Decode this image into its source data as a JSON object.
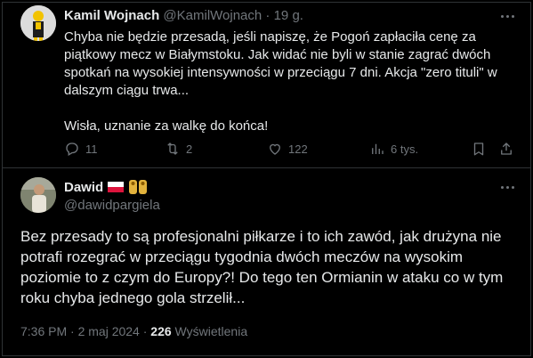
{
  "tweet1": {
    "name": "Kamil Wojnach",
    "handle": "@KamilWojnach",
    "time": "19 g.",
    "text": "Chyba nie będzie przesadą, jeśli napiszę, że Pogoń zapłaciła cenę za piątkowy mecz w Białymstoku. Jak widać nie byli w stanie zagrać dwóch spotkań na wysokiej intensywności w przeciągu 7 dni. Akcja \"zero tituli\" w dalszym ciągu trwa...\n\nWisła, uznanie za walkę do końca!",
    "replies": "11",
    "reposts": "2",
    "likes": "122",
    "views": "6 tys."
  },
  "tweet2": {
    "name": "Dawid",
    "handle": "@dawidpargiela",
    "text": "Bez przesady to są profesjonalni piłkarze i to ich zawód, jak drużyna nie potrafi rozegrać w przeciągu tygodnia dwóch meczów na wysokim poziomie to z czym do Europy?! Do tego ten Ormianin w ataku co w tym roku chyba jednego gola strzelił...",
    "timestamp": "7:36 PM · 2 maj 2024 · ",
    "views_count": "226",
    "views_label": " Wyświetlenia"
  },
  "icons": [
    "more-icon",
    "reply-icon",
    "repost-icon",
    "like-icon",
    "views-icon",
    "bookmark-icon",
    "share-icon",
    "poland-flag-icon",
    "emoji-icon"
  ],
  "colors": {
    "background": "#000000",
    "text": "#e7e9ea",
    "secondary": "#71767b",
    "border": "#2f3336"
  }
}
